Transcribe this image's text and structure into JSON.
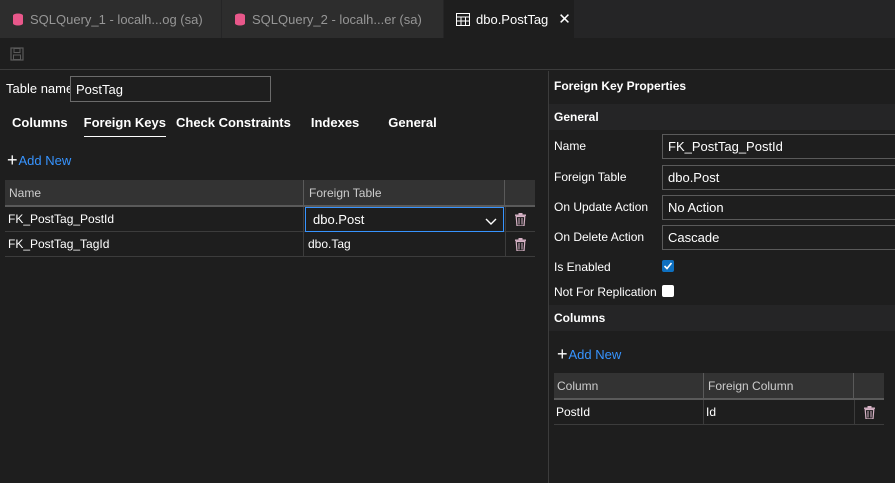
{
  "tabs": [
    {
      "label": "SQLQuery_1 - localh...og (sa)",
      "icon": "sql-file-icon",
      "dirty": true
    },
    {
      "label": "SQLQuery_2 - localh...er (sa)",
      "icon": "sql-file-icon",
      "dirty": true
    },
    {
      "label": "dbo.PostTag",
      "icon": "table-icon",
      "active": true,
      "close": "✕"
    }
  ],
  "toolbar": {
    "save_icon": "save-icon"
  },
  "table": {
    "name_label": "Table name",
    "name_value": "PostTag"
  },
  "designer_tabs": [
    "Columns",
    "Foreign Keys",
    "Check Constraints",
    "Indexes",
    "General"
  ],
  "active_designer_tab": "Foreign Keys",
  "fk_grid": {
    "add_new": "Add New",
    "headers": [
      "Name",
      "Foreign Table"
    ],
    "rows": [
      {
        "name": "FK_PostTag_PostId",
        "foreign_table": "dbo.Post",
        "selected": true
      },
      {
        "name": "FK_PostTag_TagId",
        "foreign_table": "dbo.Tag"
      }
    ]
  },
  "properties": {
    "title": "Foreign Key Properties",
    "general_section": "General",
    "name_label": "Name",
    "name_value": "FK_PostTag_PostId",
    "foreign_table_label": "Foreign Table",
    "foreign_table_value": "dbo.Post",
    "on_update_label": "On Update Action",
    "on_update_value": "No Action",
    "on_delete_label": "On Delete Action",
    "on_delete_value": "Cascade",
    "is_enabled_label": "Is Enabled",
    "is_enabled": true,
    "not_for_replication_label": "Not For Replication",
    "not_for_replication": false,
    "columns_section": "Columns",
    "add_new": "Add New",
    "col_headers": [
      "Column",
      "Foreign Column"
    ],
    "col_rows": [
      {
        "column": "PostId",
        "foreign_column": "Id"
      }
    ]
  },
  "colors": {
    "accent": "#3794ff",
    "checkbox": "#0e70c0",
    "trash": "#d7b3c6",
    "sql_icon": "#e8578a"
  }
}
